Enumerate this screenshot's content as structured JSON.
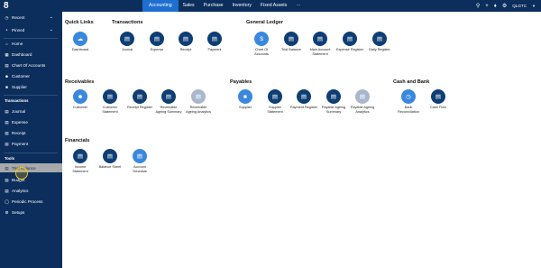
{
  "topbar": {
    "logo": "8",
    "tabs": [
      {
        "label": "Accounting",
        "active": true,
        "dropdown": false
      },
      {
        "label": "Sales",
        "active": false,
        "dropdown": false
      },
      {
        "label": "Purchase",
        "active": false,
        "dropdown": false
      },
      {
        "label": "Inventory",
        "active": false,
        "dropdown": false
      },
      {
        "label": "Fixed Assets",
        "active": false,
        "dropdown": false
      }
    ],
    "more_icon": "···",
    "org": "QLGTC",
    "colors": {
      "bar": "#0b2e5c",
      "active_tab": "#1e6fd0"
    }
  },
  "sidebar": {
    "recent": "Recent",
    "pinned": "Pinned",
    "items_top": [
      "Home",
      "Dashboard",
      "Chart Of Accounts",
      "Customer",
      "Supplier"
    ],
    "transactions_title": "Transactions",
    "transactions": [
      "Journal",
      "Expense",
      "Receipt",
      "Payment"
    ],
    "tools_title": "Tools",
    "tools": [
      "Trial Balance",
      "Budget",
      "Analytics",
      "Periodic Process",
      "Setups"
    ]
  },
  "main": {
    "quick_links": {
      "title": "Quick Links",
      "tiles": [
        "Dashboard"
      ]
    },
    "transactions": {
      "title": "Transactions",
      "tiles": [
        "Journal",
        "Expense",
        "Receipt",
        "Payment"
      ]
    },
    "general_ledger": {
      "title": "General Ledger",
      "tiles": [
        "Chart Of\nAccounts",
        "Trial Balance",
        "Main Account\nStatement",
        "Expense Register",
        "Daily Register"
      ]
    },
    "receivables": {
      "title": "Receivables",
      "tiles": [
        "Customer",
        "Customer\nStatement",
        "Receipt Register",
        "Receivable\nAgeing Summary",
        "Receivable\nAgeing Analytics"
      ]
    },
    "payables": {
      "title": "Payables",
      "tiles": [
        "Supplier",
        "Supplier\nStatement",
        "Payment Register",
        "Payable Ageing\nSummary",
        "Payable Ageing\nAnalytics"
      ]
    },
    "cash_and_bank": {
      "title": "Cash and Bank",
      "tiles": [
        "Bank\nReconciliation",
        "Cash Flow"
      ]
    },
    "financials": {
      "title": "Financials",
      "tiles": [
        "Income\nStatement",
        "Balance Sheet",
        "Account\nSchedule"
      ]
    }
  }
}
